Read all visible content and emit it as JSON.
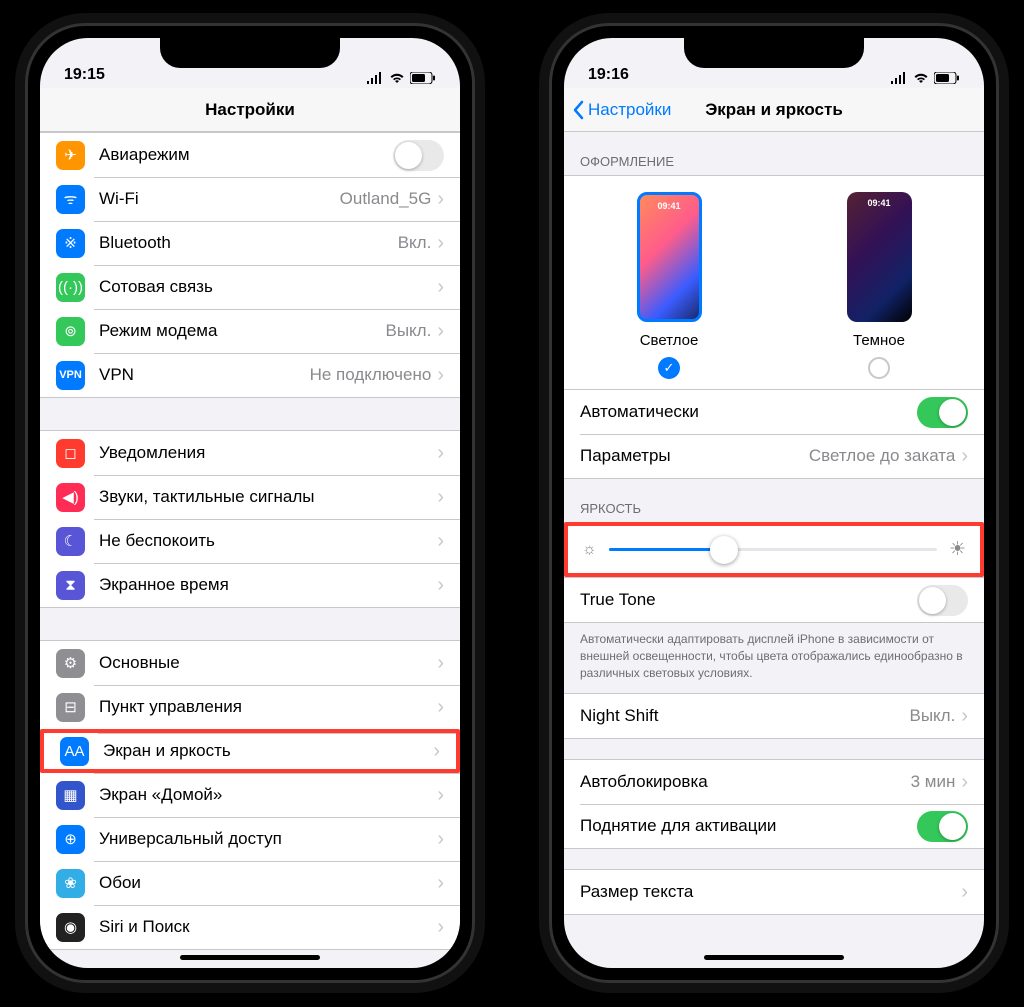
{
  "left": {
    "time": "19:15",
    "title": "Настройки",
    "groups": [
      [
        {
          "icon": "airplane",
          "color": "#ff9500",
          "label": "Авиарежим",
          "type": "toggle",
          "toggle": "off"
        },
        {
          "icon": "wifi",
          "color": "#007aff",
          "label": "Wi-Fi",
          "value": "Outland_5G",
          "type": "nav"
        },
        {
          "icon": "bluetooth",
          "color": "#007aff",
          "label": "Bluetooth",
          "value": "Вкл.",
          "type": "nav"
        },
        {
          "icon": "cellular",
          "color": "#34c759",
          "label": "Сотовая связь",
          "type": "nav"
        },
        {
          "icon": "hotspot",
          "color": "#34c759",
          "label": "Режим модема",
          "value": "Выкл.",
          "type": "nav"
        },
        {
          "icon": "vpn",
          "color": "#007aff",
          "label": "VPN",
          "value": "Не подключено",
          "type": "nav"
        }
      ],
      [
        {
          "icon": "notifications",
          "color": "#ff3b30",
          "label": "Уведомления",
          "type": "nav"
        },
        {
          "icon": "sounds",
          "color": "#ff2d55",
          "label": "Звуки, тактильные сигналы",
          "type": "nav"
        },
        {
          "icon": "dnd",
          "color": "#5856d6",
          "label": "Не беспокоить",
          "type": "nav"
        },
        {
          "icon": "screentime",
          "color": "#5856d6",
          "label": "Экранное время",
          "type": "nav"
        }
      ],
      [
        {
          "icon": "general",
          "color": "#8e8e93",
          "label": "Основные",
          "type": "nav"
        },
        {
          "icon": "control",
          "color": "#8e8e93",
          "label": "Пункт управления",
          "type": "nav"
        },
        {
          "icon": "display",
          "color": "#007aff",
          "label": "Экран и яркость",
          "type": "nav",
          "highlight": true
        },
        {
          "icon": "home",
          "color": "#3355cc",
          "label": "Экран «Домой»",
          "type": "nav"
        },
        {
          "icon": "accessibility",
          "color": "#007aff",
          "label": "Универсальный доступ",
          "type": "nav"
        },
        {
          "icon": "wallpaper",
          "color": "#32ade6",
          "label": "Обои",
          "type": "nav"
        },
        {
          "icon": "siri",
          "color": "#222",
          "label": "Siri и Поиск",
          "type": "nav"
        }
      ]
    ]
  },
  "right": {
    "time": "19:16",
    "back": "Настройки",
    "title": "Экран и яркость",
    "sec_appearance": "ОФОРМЛЕНИЕ",
    "light": "Светлое",
    "dark": "Темное",
    "thumb_time": "09:41",
    "auto": "Автоматически",
    "options": "Параметры",
    "options_val": "Светлое до заката",
    "sec_brightness": "ЯРКОСТЬ",
    "truetone": "True Tone",
    "tt_desc": "Автоматически адаптировать дисплей iPhone в зависимости от внешней освещенности, чтобы цвета отображались единообразно в различных световых условиях.",
    "nightshift": "Night Shift",
    "nightshift_val": "Выкл.",
    "autolock": "Автоблокировка",
    "autolock_val": "3 мин",
    "raise": "Поднятие для активации",
    "textsize": "Размер текста"
  }
}
